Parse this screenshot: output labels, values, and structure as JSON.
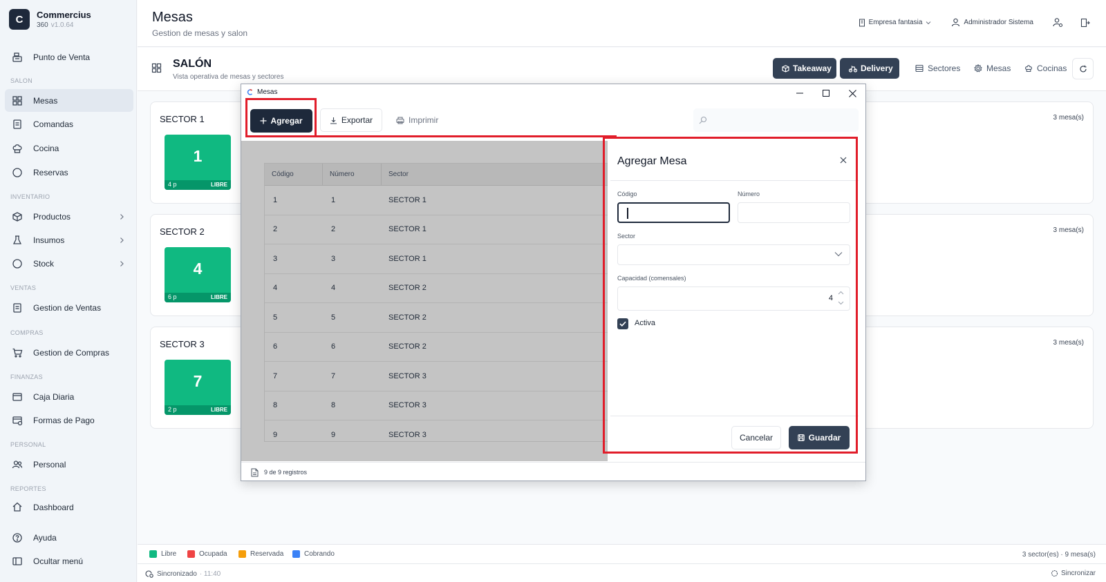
{
  "brand": {
    "letter": "C",
    "name": "Commercius",
    "edition": "360",
    "version": "v1.0.64"
  },
  "sidebar": {
    "top_item": "Punto de Venta",
    "sections": [
      {
        "title": "SALON",
        "items": [
          "Mesas",
          "Comandas",
          "Cocina",
          "Reservas"
        ]
      },
      {
        "title": "INVENTARIO",
        "items": [
          "Productos",
          "Insumos",
          "Stock"
        ]
      },
      {
        "title": "VENTAS",
        "items": [
          "Gestion de Ventas"
        ]
      },
      {
        "title": "COMPRAS",
        "items": [
          "Gestion de Compras"
        ]
      },
      {
        "title": "FINANZAS",
        "items": [
          "Caja Diaria",
          "Formas de Pago"
        ]
      },
      {
        "title": "PERSONAL",
        "items": [
          "Personal"
        ]
      },
      {
        "title": "REPORTES",
        "items": [
          "Dashboard"
        ]
      }
    ],
    "help": "Ayuda",
    "hide_menu": "Ocultar menú"
  },
  "header": {
    "title": "Mesas",
    "subtitle": "Gestion de mesas y salon",
    "company": "Empresa fantasia",
    "user": "Administrador Sistema"
  },
  "salon": {
    "title": "SALÓN",
    "subtitle": "Vista operativa de mesas y sectores",
    "takeaway": "Takeaway",
    "delivery": "Delivery",
    "sectores": "Sectores",
    "mesas": "Mesas",
    "cocinas": "Cocinas"
  },
  "sectors": [
    {
      "name": "SECTOR 1",
      "count": "3 mesa(s)",
      "tile": {
        "number": "1",
        "capacity": "4 p",
        "status": "LIBRE"
      }
    },
    {
      "name": "SECTOR 2",
      "count": "3 mesa(s)",
      "tile": {
        "number": "4",
        "capacity": "6 p",
        "status": "LIBRE"
      }
    },
    {
      "name": "SECTOR 3",
      "count": "3 mesa(s)",
      "tile": {
        "number": "7",
        "capacity": "2 p",
        "status": "LIBRE"
      }
    }
  ],
  "legend": {
    "items": [
      {
        "label": "Libre",
        "color": "#10b981"
      },
      {
        "label": "Ocupada",
        "color": "#ef4444"
      },
      {
        "label": "Reservada",
        "color": "#f59e0b"
      },
      {
        "label": "Cobrando",
        "color": "#3b82f6"
      }
    ],
    "summary": "3 sector(es) · 9 mesa(s)"
  },
  "status": {
    "sync": "Sincronizado",
    "time": "· 11:40",
    "sync_button": "Sincronizar"
  },
  "window": {
    "title": "Mesas",
    "toolbar": {
      "add": "Agregar",
      "export": "Exportar",
      "print": "Imprimir",
      "search_placeholder": ""
    },
    "grid": {
      "columns": [
        "Código",
        "Número",
        "Sector"
      ],
      "rows": [
        [
          "1",
          "1",
          "SECTOR 1"
        ],
        [
          "2",
          "2",
          "SECTOR 1"
        ],
        [
          "3",
          "3",
          "SECTOR 1"
        ],
        [
          "4",
          "4",
          "SECTOR 2"
        ],
        [
          "5",
          "5",
          "SECTOR 2"
        ],
        [
          "6",
          "6",
          "SECTOR 2"
        ],
        [
          "7",
          "7",
          "SECTOR 3"
        ],
        [
          "8",
          "8",
          "SECTOR 3"
        ],
        [
          "9",
          "9",
          "SECTOR 3"
        ]
      ]
    },
    "footer": "9 de 9 registros",
    "form": {
      "title": "Agregar Mesa",
      "codigo_label": "Código",
      "codigo_value": "",
      "numero_label": "Número",
      "numero_value": "",
      "sector_label": "Sector",
      "sector_value": "",
      "capacidad_label": "Capacidad (comensales)",
      "capacidad_value": "4",
      "activa_label": "Activa",
      "activa_checked": true,
      "cancel": "Cancelar",
      "save": "Guardar"
    }
  },
  "colors": {
    "accent": "#334155",
    "free": "#10b981",
    "highlight": "#e11d2a"
  }
}
